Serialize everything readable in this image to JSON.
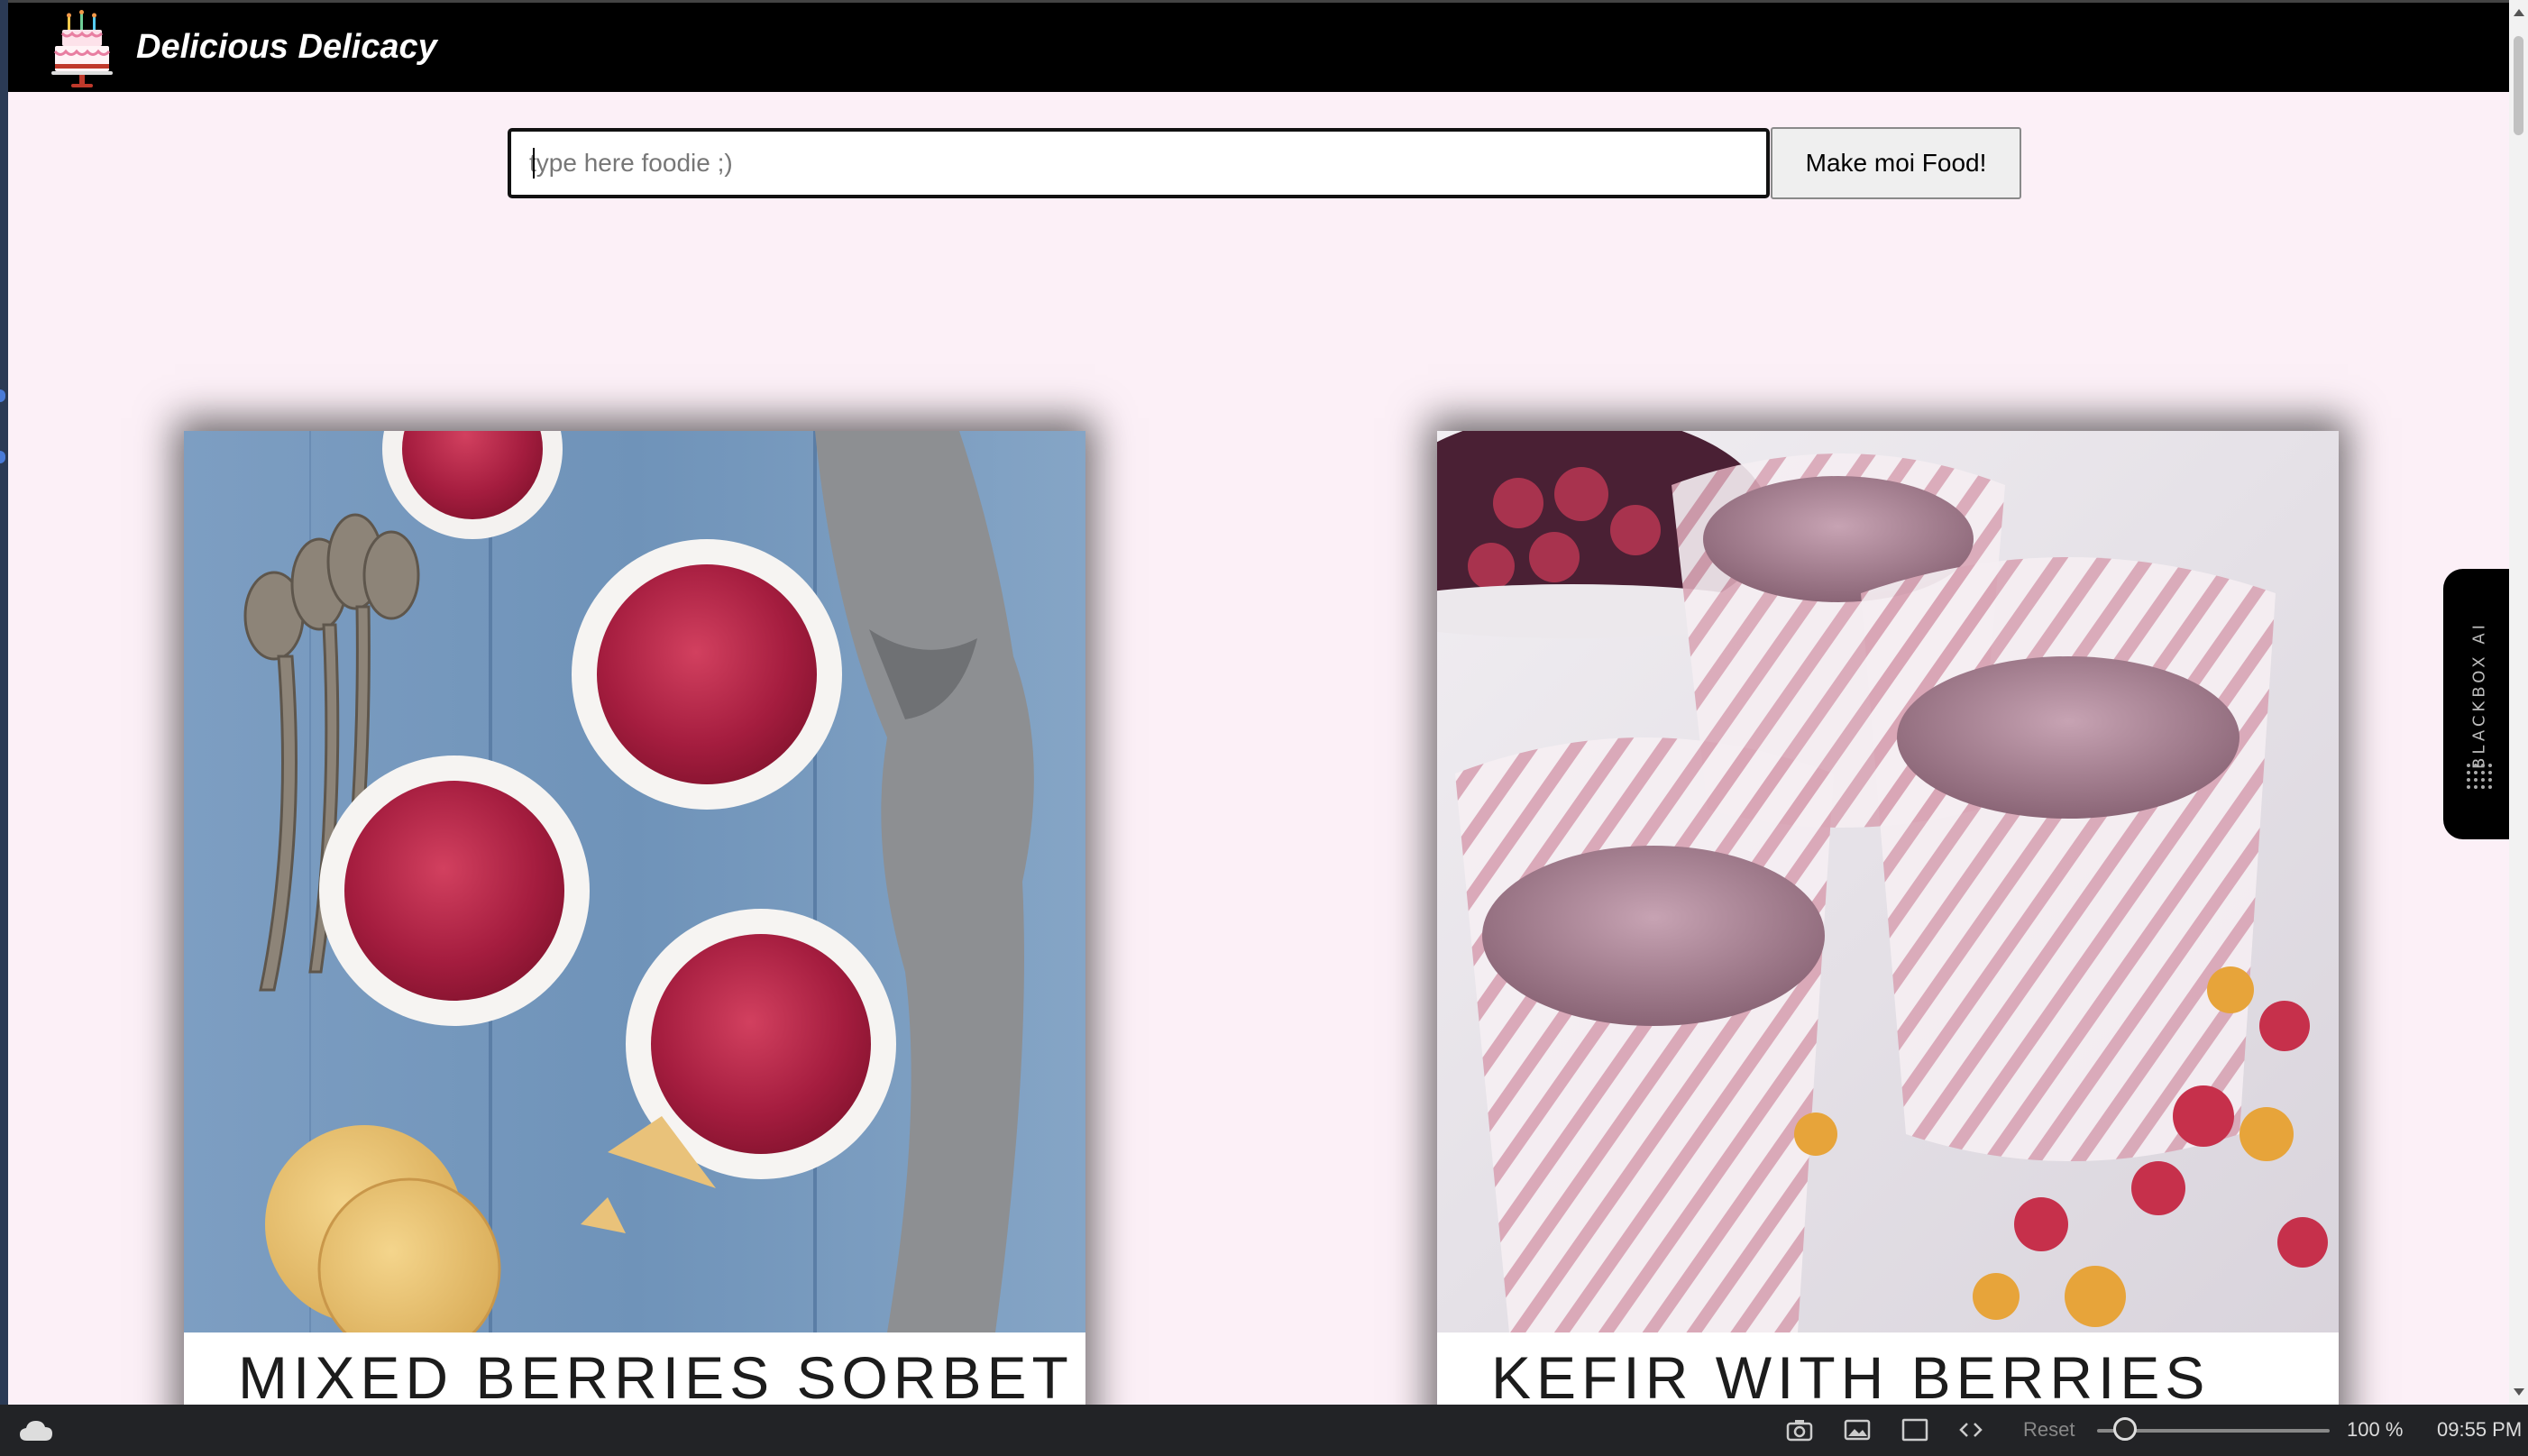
{
  "app": {
    "brand": "Delicious Delicacy"
  },
  "search": {
    "placeholder": "type here foodie ;)",
    "value": "",
    "button_label": "Make moi Food!"
  },
  "recipes": [
    {
      "title": "MIXED BERRIES SORBET",
      "image": "berry-sorbet-photo"
    },
    {
      "title": "KEFIR WITH BERRIES",
      "image": "kefir-berries-photo"
    }
  ],
  "extension": {
    "label": "BLACKBOX AI"
  },
  "taskbar": {
    "reset_label": "Reset",
    "zoom_text": "100 %",
    "zoom_fraction": 0.12,
    "clock": "09:55 PM",
    "icons": [
      "camera-icon",
      "image-icon",
      "window-icon",
      "code-icon"
    ]
  },
  "colors": {
    "page_bg": "#fcf0f7",
    "navbar_bg": "#000000",
    "taskbar_bg": "#222326"
  }
}
